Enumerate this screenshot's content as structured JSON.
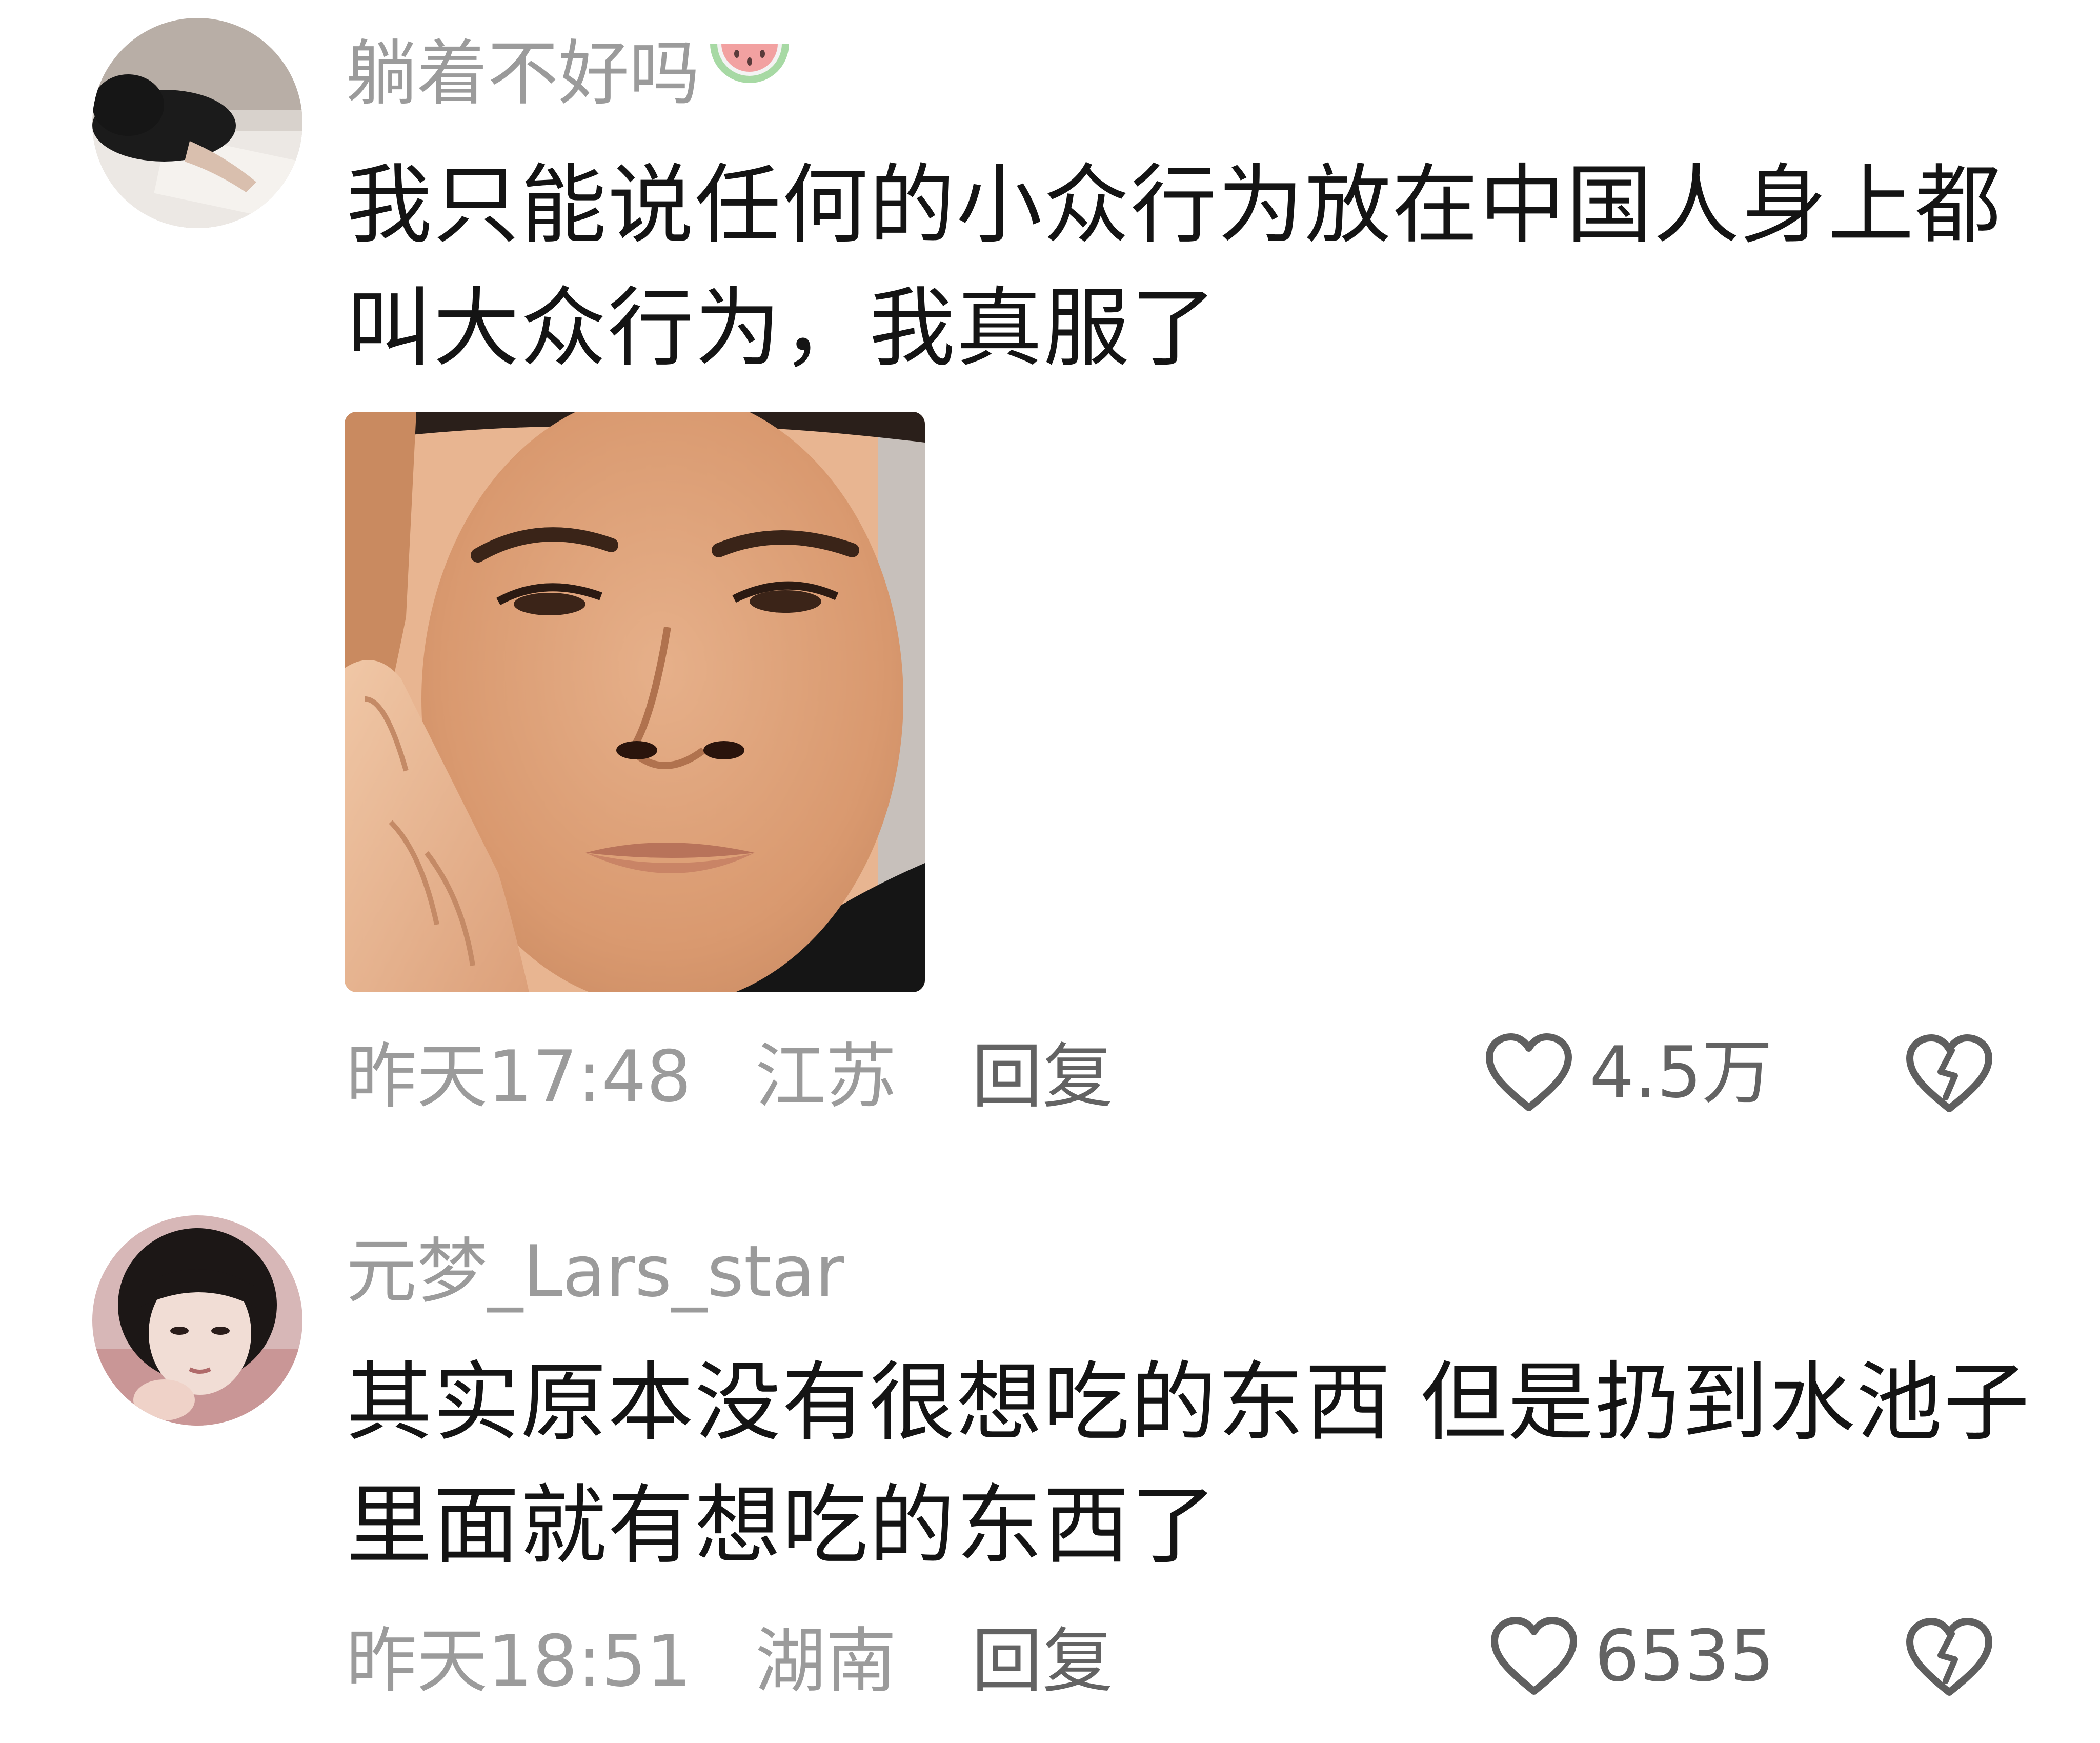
{
  "comments": [
    {
      "username": "躺着不好吗",
      "username_badge_icon": "watermelon-icon",
      "text": "我只能说任何的小众行为放在中国人身上都叫大众行为，我真服了",
      "sticker_icon": "thinking-face-sticker",
      "timestamp": "昨天17:48",
      "location": "江苏",
      "reply_label": "回复",
      "like_count": "4.5万",
      "like_icon": "heart-outline-icon",
      "dislike_icon": "broken-heart-icon"
    },
    {
      "username": "元梦_Lars_star",
      "text": "其实原本没有很想吃的东西 但是扔到水池子里面就有想吃的东西了",
      "timestamp": "昨天18:51",
      "location": "湖南",
      "reply_label": "回复",
      "like_count": "6535",
      "like_icon": "heart-outline-icon",
      "dislike_icon": "broken-heart-icon"
    }
  ],
  "colors": {
    "background": "#ffffff",
    "text_primary": "#141414",
    "text_secondary": "#9b9b9b",
    "text_action": "#636363",
    "watermelon_red": "#f08080",
    "watermelon_green": "#a7d9a4"
  }
}
